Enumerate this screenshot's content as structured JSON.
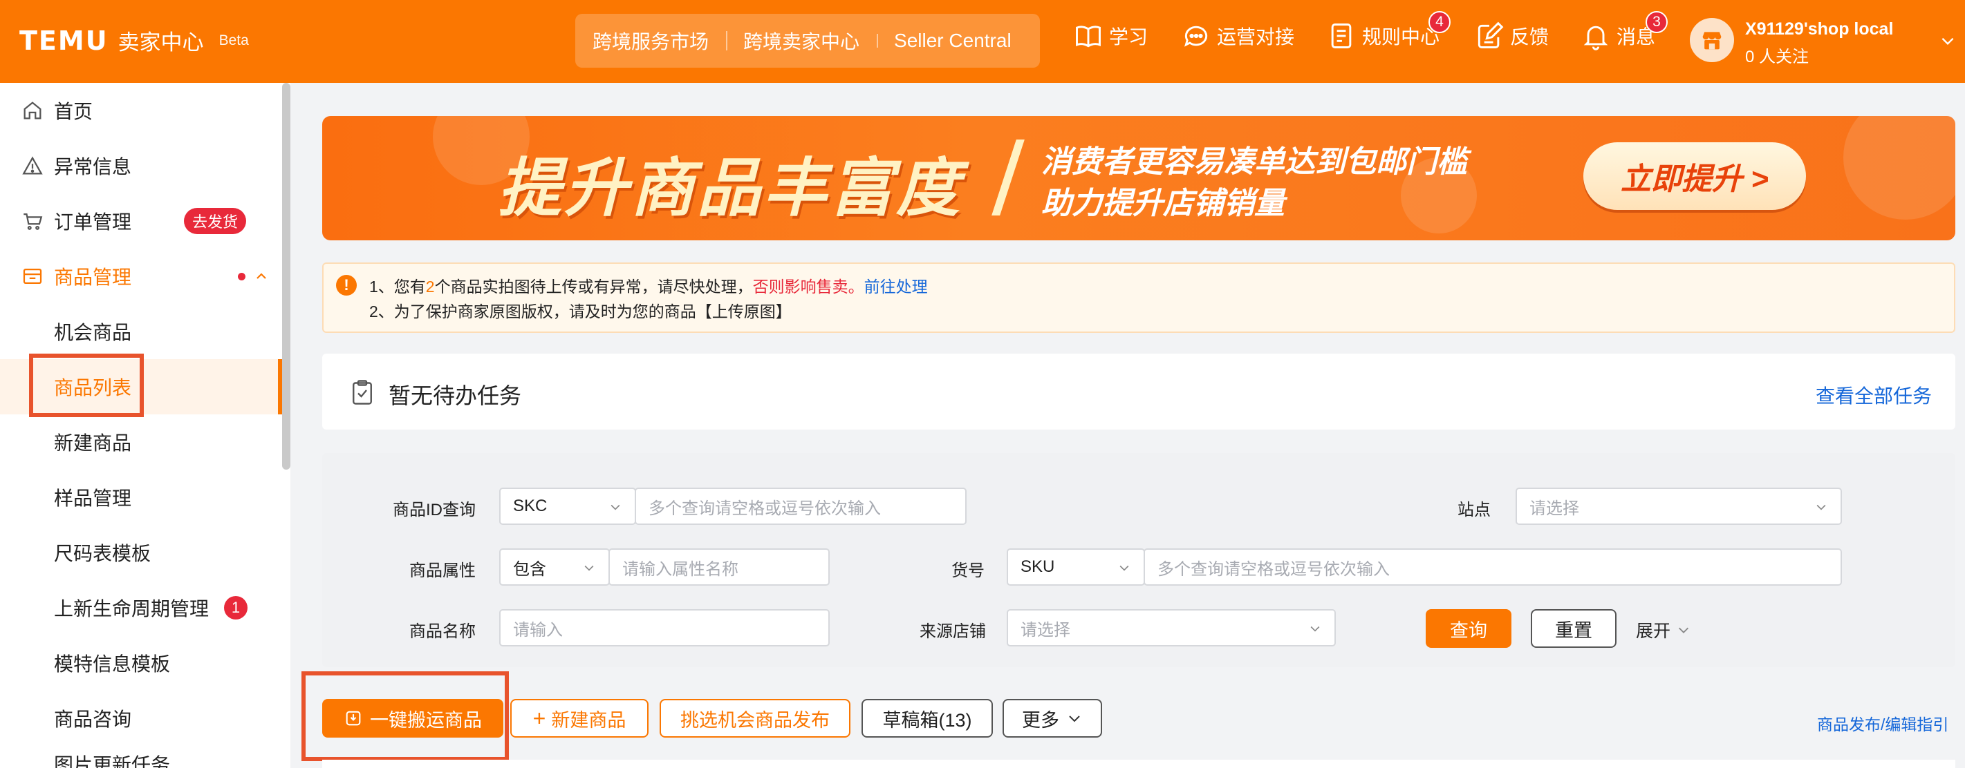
{
  "header": {
    "logo": "TEMU",
    "brand_sub": "卖家中心",
    "beta": "Beta",
    "nav_links": [
      "跨境服务市场",
      "跨境卖家中心",
      "Seller Central"
    ],
    "learn": "学习",
    "ops": "运营对接",
    "rules": "规则中心",
    "rules_badge": "4",
    "feedback": "反馈",
    "messages": "消息",
    "messages_badge": "3",
    "account_name": "X91129'shop local",
    "account_followers": "0 人关注"
  },
  "sidebar": {
    "items": [
      {
        "label": "首页",
        "icon": "home-icon"
      },
      {
        "label": "异常信息",
        "icon": "warning-icon"
      },
      {
        "label": "订单管理",
        "icon": "cart-icon",
        "badge": "去发货"
      },
      {
        "label": "商品管理",
        "icon": "box-icon"
      },
      {
        "label": "机会商品"
      },
      {
        "label": "商品列表"
      },
      {
        "label": "新建商品"
      },
      {
        "label": "样品管理"
      },
      {
        "label": "尺码表模板"
      },
      {
        "label": "上新生命周期管理",
        "badge": "1"
      },
      {
        "label": "模特信息模板"
      },
      {
        "label": "商品咨询"
      },
      {
        "label": "图片更新任务"
      }
    ]
  },
  "banner": {
    "title": "提升商品丰富度",
    "line1": "消费者更容易凑单达到包邮门槛",
    "line2": "助力提升店铺销量",
    "button": "立即提升 >"
  },
  "notice": {
    "l1_a": "1、您有",
    "l1_count": "2",
    "l1_b": "个商品实拍图待上传或有异常，请尽快处理，",
    "l1_warn": "否则影响售卖。",
    "l1_link": "前往处理",
    "l2": "2、为了保护商家原图版权，请及时为您的商品【上传原图】"
  },
  "tasks": {
    "title": "暂无待办任务",
    "view_all": "查看全部任务"
  },
  "filters": {
    "id_label": "商品ID查询",
    "id_type": "SKC",
    "id_placeholder": "多个查询请空格或逗号依次输入",
    "site_label": "站点",
    "site_placeholder": "请选择",
    "attr_label": "商品属性",
    "attr_mode": "包含",
    "attr_placeholder": "请输入属性名称",
    "sku_label": "货号",
    "sku_type": "SKU",
    "sku_placeholder": "多个查询请空格或逗号依次输入",
    "name_label": "商品名称",
    "name_placeholder": "请输入",
    "source_label": "来源店铺",
    "source_placeholder": "请选择",
    "query": "查询",
    "reset": "重置",
    "expand": "展开"
  },
  "actions": {
    "one_click": "一键搬运商品",
    "new_product": "新建商品",
    "pick_opportunity": "挑选机会商品发布",
    "drafts": "草稿箱(13)",
    "more": "更多",
    "guide": "商品发布/编辑指引"
  },
  "colors": {
    "brand": "#fb7701",
    "badge_red": "#e8293a",
    "link_blue": "#1567d9",
    "highlight_box": "#e8532c"
  }
}
